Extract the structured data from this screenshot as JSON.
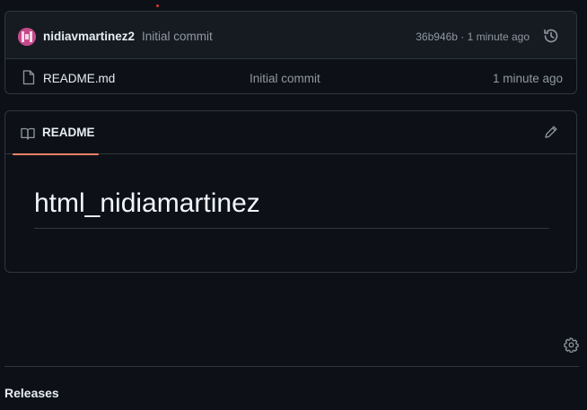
{
  "latest_commit": {
    "author": "nidiavmartinez2",
    "message": "Initial commit",
    "meta": "36b946b · 1 minute ago"
  },
  "files": [
    {
      "name": "README.md",
      "commit_message": "Initial commit",
      "time": "1 minute ago"
    }
  ],
  "readme": {
    "tab_label": "README",
    "title": "html_nidiamartinez"
  },
  "sidebar": {
    "releases_heading": "Releases"
  },
  "colors": {
    "background": "#0d1117",
    "accent_underline": "#f78166",
    "border": "#30363d",
    "avatar": "#c44a8b"
  },
  "icons": [
    "avatar",
    "history-icon",
    "file-icon",
    "book-icon",
    "pencil-icon",
    "gear-icon"
  ]
}
